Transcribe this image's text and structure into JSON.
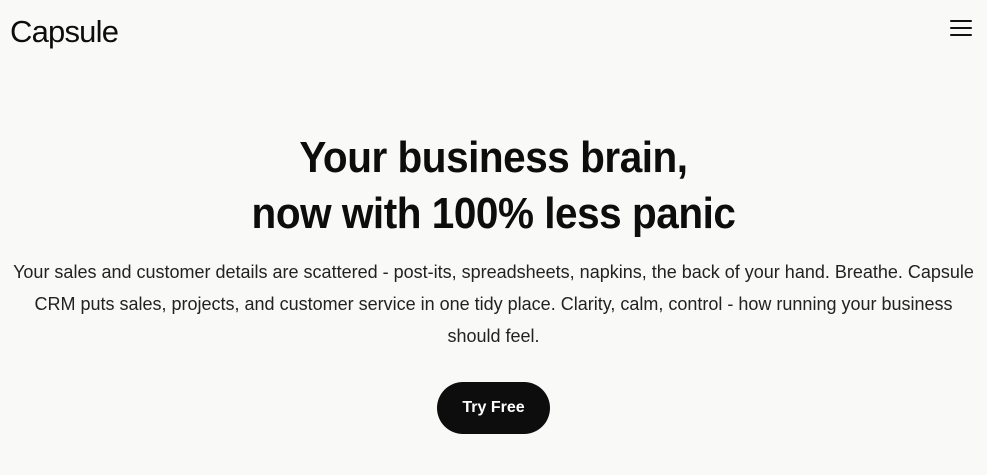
{
  "header": {
    "logo_text": "Capsule",
    "menu_icon": "hamburger-menu-icon"
  },
  "hero": {
    "headline_line1": "Your business brain,",
    "headline_line2": "now with 100% less panic",
    "subtext": "Your sales and customer details are scattered - post-its, spreadsheets, napkins, the back of your hand. Breathe. Capsule CRM puts sales, projects, and customer service in one tidy place. Clarity, calm, control - how running your business should feel.",
    "cta_label": "Try Free"
  },
  "colors": {
    "background": "#f9f9f7",
    "text": "#0d0d0d",
    "cta_background": "#0d0d0d",
    "cta_text": "#ffffff"
  }
}
